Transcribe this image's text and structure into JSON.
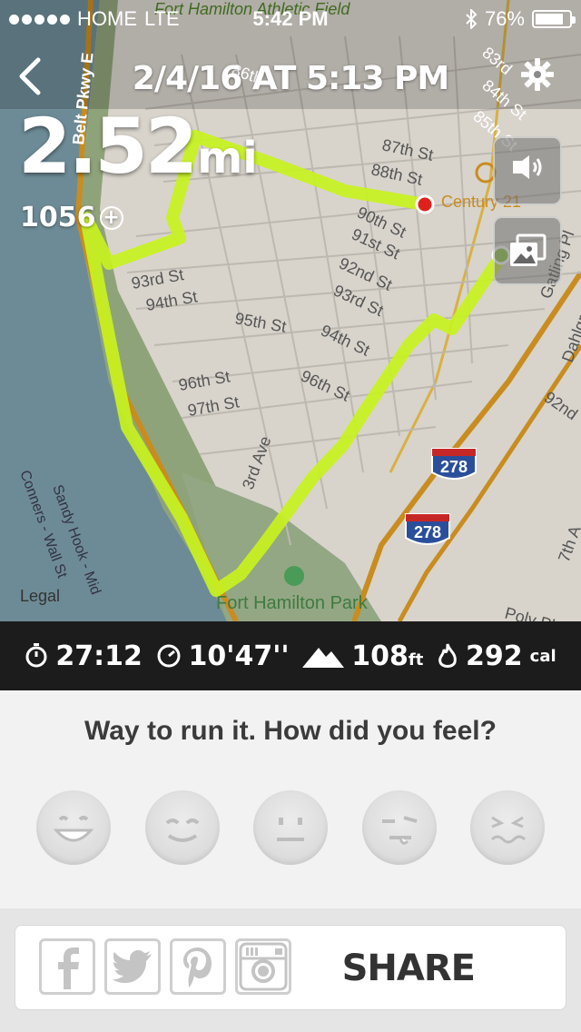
{
  "status_bar": {
    "carrier": "HOME",
    "network": "LTE",
    "time": "5:42 PM",
    "battery": "76%"
  },
  "header": {
    "title": "2/4/16 AT 5:13 PM"
  },
  "run": {
    "distance_value": "2.52",
    "distance_unit": "mi",
    "points": "1056"
  },
  "map": {
    "legal": "Legal",
    "labels": {
      "fort_hamilton_athletic_field": "Fort Hamilton Athletic Field",
      "belt_pkwy": "Belt Pkwy E",
      "st_86": "86th",
      "st_87": "87th St",
      "st_88": "88th St",
      "st_90": "90th St",
      "st_91": "91st St",
      "st_92": "92nd St",
      "st_93": "93rd St",
      "st_94": "94th St",
      "st_95": "95th St",
      "st_96": "96th St",
      "st_97": "97th St",
      "ave_3": "3rd Ave",
      "century21": "Century 21",
      "fort_hamilton_park": "Fort Hamilton Park",
      "i278": "278",
      "gatling": "Gatling Pl",
      "dahlgren": "Dahlgren",
      "conners": "Conners - Wall St",
      "sandy_hook": "Sandy Hook - Mid",
      "poly": "Poly Pl",
      "ave_7": "7th A",
      "st_83": "83rd",
      "st_84": "84th St",
      "st_85": "85th St",
      "st_92_right": "92nd"
    },
    "route_color": "#c8f21e",
    "start_color": "#8cc63f",
    "end_color": "#e0201c"
  },
  "stats": {
    "duration": "27:12",
    "pace": "10'47''",
    "elevation": "108",
    "elevation_unit": "ft",
    "calories": "292",
    "calories_unit": "cal"
  },
  "feel": {
    "question": "Way to run it. How did you feel?",
    "options": [
      "great-face",
      "good-face",
      "ok-face",
      "meh-face",
      "bad-face"
    ]
  },
  "share": {
    "label": "SHARE",
    "icons": [
      "facebook-icon",
      "twitter-icon",
      "pinterest-icon",
      "instagram-icon"
    ]
  }
}
